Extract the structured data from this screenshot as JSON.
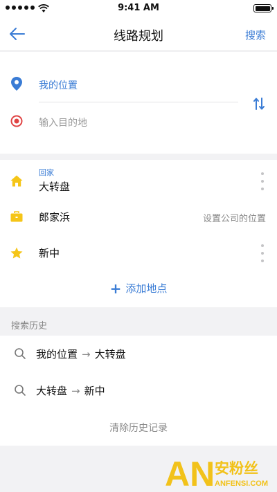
{
  "status_bar": {
    "time": "9:41 AM"
  },
  "nav": {
    "title": "线路规划",
    "search_label": "搜索"
  },
  "route": {
    "from": "我的位置",
    "to_placeholder": "输入目的地"
  },
  "places": [
    {
      "tag": "回家",
      "name": "大转盘",
      "icon": "home-icon",
      "color": "#f5c518"
    },
    {
      "name": "郎家浜",
      "hint": "设置公司的位置",
      "icon": "briefcase-icon",
      "color": "#f5c518"
    },
    {
      "name": "新中",
      "icon": "star-icon",
      "color": "#f5c518"
    }
  ],
  "add_place_label": "添加地点",
  "history": {
    "header": "搜索历史",
    "items": [
      {
        "from": "我的位置",
        "arrow": "→",
        "to": "大转盘"
      },
      {
        "from": "大转盘",
        "arrow": "→",
        "to": "新中"
      }
    ],
    "clear_label": "清除历史记录"
  },
  "watermark": {
    "brand": "AN",
    "cn": "安粉丝",
    "domain": "ANFENSI.COM"
  },
  "colors": {
    "accent": "#3a7cd5",
    "target_red": "#e04343",
    "place_yellow": "#f5c518"
  }
}
